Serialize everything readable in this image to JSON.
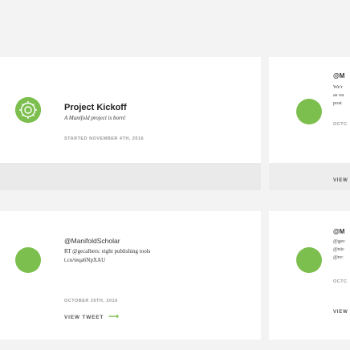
{
  "colors": {
    "accent": "#7cbf4e",
    "background": "#f3f3f3",
    "card": "#ffffff"
  },
  "cards": [
    {
      "title": "Project Kickoff",
      "subtitle": "A Manifold project is born!",
      "date": "STARTED NOVEMBER 4TH, 2016",
      "icon": "manifold-logo-icon"
    },
    {
      "handle": "@ManifoldScholar",
      "line1": "RT @gecalbers: eight publishing tools",
      "line2": "t.co/teqa6NpXAU",
      "date": "OCTOBER 26TH, 2016",
      "link": "VIEW TWEET",
      "arrow": "⟶"
    }
  ],
  "side_cards": [
    {
      "title": "@M",
      "lines": [
        "We'r",
        "as ou",
        "post"
      ],
      "date": "OCTC",
      "link": "VIEW"
    },
    {
      "title": "@M",
      "lines": [
        "@gec",
        "@nic",
        "@re:"
      ],
      "date": "OCTC",
      "link": "VIEW"
    }
  ]
}
